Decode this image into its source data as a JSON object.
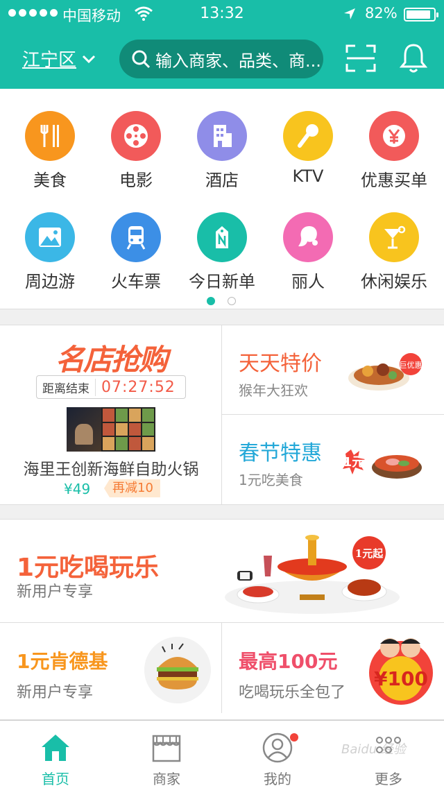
{
  "status_bar": {
    "carrier": "中国移动",
    "time": "13:32",
    "battery": "82%",
    "battery_level": 0.82
  },
  "header": {
    "city": "江宁区",
    "search_placeholder": "输入商家、品类、商...",
    "icons": [
      "chevron-down-icon",
      "search-icon",
      "scan-icon",
      "bell-icon"
    ]
  },
  "categories": [
    {
      "label": "美食",
      "icon": "fork-spoon-icon",
      "color": "#f8961e"
    },
    {
      "label": "电影",
      "icon": "film-reel-icon",
      "color": "#f25a5a"
    },
    {
      "label": "酒店",
      "icon": "building-icon",
      "color": "#8f8de8"
    },
    {
      "label": "KTV",
      "icon": "microphone-icon",
      "color": "#f8c41e"
    },
    {
      "label": "优惠买单",
      "icon": "yen-coin-icon",
      "color": "#f25a5a"
    },
    {
      "label": "周边游",
      "icon": "landscape-icon",
      "color": "#3bb7e6"
    },
    {
      "label": "火车票",
      "icon": "train-icon",
      "color": "#3c8fe6"
    },
    {
      "label": "今日新单",
      "icon": "tag-icon",
      "color": "#19bea8"
    },
    {
      "label": "丽人",
      "icon": "lady-icon",
      "color": "#f36bb3"
    },
    {
      "label": "休闲娱乐",
      "icon": "cocktail-icon",
      "color": "#f8c41e"
    }
  ],
  "pager": {
    "pages": 2,
    "active": 1
  },
  "flash_sale": {
    "title": "名店抢购",
    "countdown_label": "距离结束",
    "countdown": "07:27:52",
    "deal_title": "海里王创新海鲜自助火锅",
    "price": "¥49",
    "discount": "再减10"
  },
  "promos": [
    {
      "title": "天天特价",
      "subtitle": "猴年大狂欢",
      "badge": "巨优惠"
    },
    {
      "title": "春节特惠",
      "subtitle": "1元吃美食",
      "badge": "1元"
    }
  ],
  "banner": {
    "title": "1元吃喝玩乐",
    "subtitle": "新用户专享",
    "badge": "1元起"
  },
  "cards": [
    {
      "title": "1元肯德基",
      "subtitle": "新用户专享"
    },
    {
      "title": "最高100元",
      "subtitle": "吃喝玩乐全包了",
      "badge": "¥100"
    }
  ],
  "tabbar": [
    {
      "label": "首页",
      "icon": "home-icon",
      "active": true
    },
    {
      "label": "商家",
      "icon": "store-icon",
      "active": false
    },
    {
      "label": "我的",
      "icon": "user-icon",
      "active": false,
      "dot": true
    },
    {
      "label": "更多",
      "icon": "more-icon",
      "active": false
    }
  ],
  "watermark": "Baidu 经验",
  "colors": {
    "brand": "#19bea8",
    "accent": "#f4623a",
    "badge_red": "#f2433a"
  }
}
